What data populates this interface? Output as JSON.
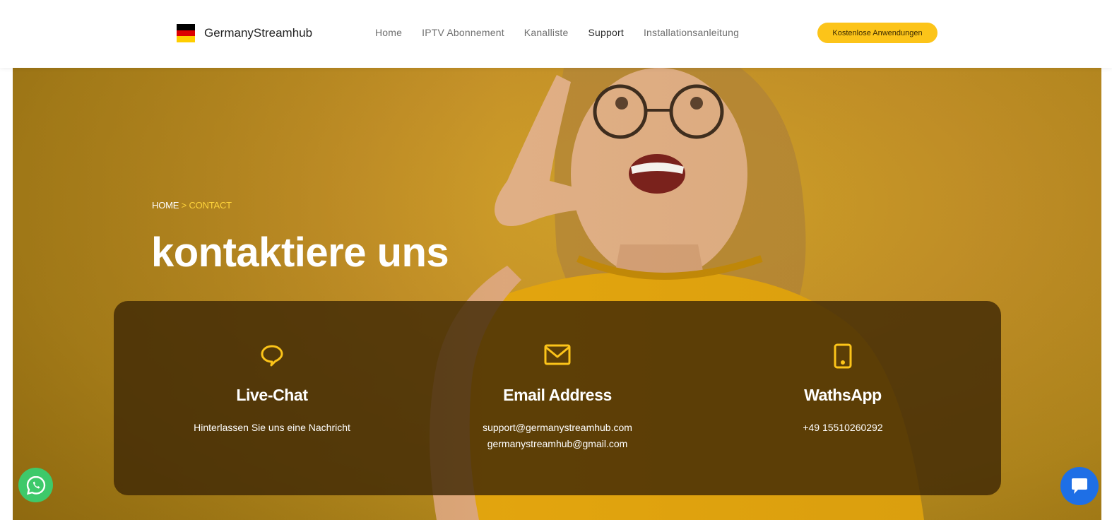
{
  "header": {
    "brand_name": "GermanyStreamhub",
    "nav": [
      {
        "label": "Home"
      },
      {
        "label": "IPTV Abonnement"
      },
      {
        "label": "Kanalliste"
      },
      {
        "label": "Support"
      },
      {
        "label": "Installationsanleitung"
      }
    ],
    "cta_label": "Kostenlose Anwendungen"
  },
  "hero": {
    "breadcrumb_home": "HOME",
    "breadcrumb_sep": ">",
    "breadcrumb_current": "CONTACT",
    "title": "kontaktiere uns"
  },
  "contact": {
    "live_chat": {
      "icon": "chat-bubble-icon",
      "title": "Live-Chat",
      "text": "Hinterlassen Sie uns eine Nachricht"
    },
    "email": {
      "icon": "envelope-icon",
      "title": "Email Address",
      "line1": "support@germanystreamhub.com",
      "line2": "germanystreamhub@gmail.com"
    },
    "whatsapp": {
      "icon": "phone-icon",
      "title": "WathsApp",
      "text": "+49 15510260292"
    }
  },
  "floating": {
    "whatsapp_icon": "whatsapp-icon",
    "chat_icon": "chat-widget-icon"
  },
  "colors": {
    "accent": "#fcc419",
    "hero_bg": "#c9952a",
    "card_bg": "#40280599",
    "whatsapp": "#3ec96a",
    "chat_widget": "#1e6fe6"
  }
}
